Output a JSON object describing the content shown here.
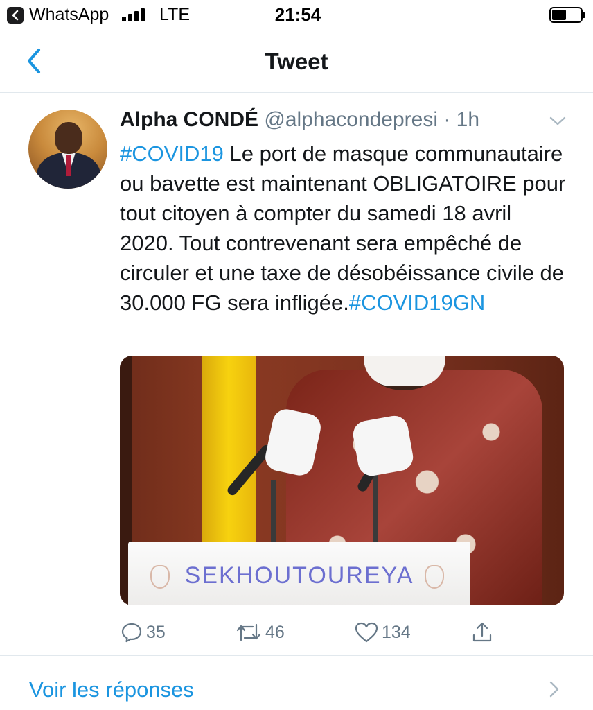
{
  "status_bar": {
    "back_app": "WhatsApp",
    "network": "LTE",
    "time": "21:54",
    "battery_level": 0.5
  },
  "header": {
    "title": "Tweet"
  },
  "tweet": {
    "author_name": "Alpha CONDÉ",
    "author_handle": "@alphacondepresi",
    "separator": "·",
    "time": "1h",
    "text": {
      "hashtag_start": "#COVID19",
      "body": " Le port de masque communautaire ou bavette est maintenant OBLIGATOIRE pour tout citoyen à compter du samedi 18 avril 2020. Tout contrevenant sera empêché de circuler et une taxe de désobéissance civile de 30.000 FG sera infligée.",
      "hashtag_end": "#COVID19GN"
    },
    "media": {
      "podium_text": "SEKHOUTOUREYA"
    },
    "actions": {
      "replies": "35",
      "retweets": "46",
      "likes": "134"
    }
  },
  "replies_link": {
    "label": "Voir les réponses"
  },
  "colors": {
    "accent": "#1b95e0",
    "secondary_text": "#657786",
    "primary_text": "#14171a"
  }
}
